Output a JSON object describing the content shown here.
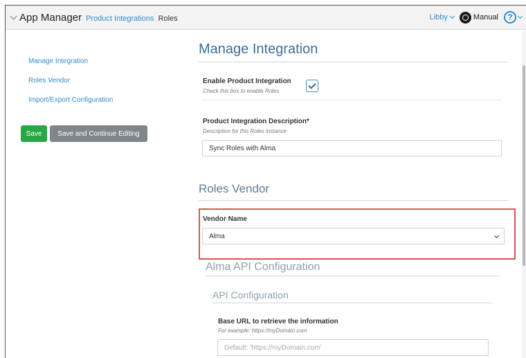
{
  "header": {
    "app_title": "App Manager",
    "breadcrumb_link": "Product Integrations",
    "breadcrumb_current": "Roles",
    "user": "Libby",
    "manual": "Manual",
    "help_glyph": "?"
  },
  "sidebar": {
    "links": [
      "Manage Integration",
      "Roles Vendor",
      "Import/Export Configuration"
    ],
    "save_label": "Save",
    "save_continue_label": "Save and Continue Editing"
  },
  "main": {
    "title": "Manage Integration",
    "enable": {
      "label": "Enable Product Integration",
      "hint": "Check this box to enable Roles",
      "checked": true
    },
    "description": {
      "label": "Product Integration Description*",
      "hint": "Description for this Roles instance",
      "value": "Sync Roles with Alma"
    },
    "vendor_section_title": "Roles Vendor",
    "vendor": {
      "label": "Vendor Name",
      "selected": "Alma"
    },
    "alma_section_title": "Alma API Configuration",
    "api_section_title": "API Configuration",
    "base_url": {
      "label": "Base URL to retrieve the information",
      "hint": "For example: https://myDomain.com",
      "placeholder": "Default: 'https://myDomain.com'"
    }
  },
  "colors": {
    "accent_blue": "#2e8ccf",
    "save_green": "#27a745",
    "secondary_gray": "#7f878c",
    "highlight_red": "#d9534f"
  }
}
